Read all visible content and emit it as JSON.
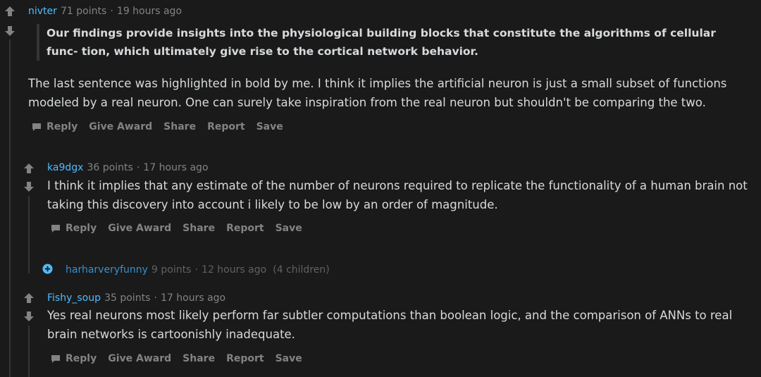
{
  "comments": [
    {
      "author": "nivter",
      "points": "71 points",
      "time": "19 hours ago",
      "quote": "Our findings provide insights into the physiological building blocks that constitute the algorithms of cellular func- tion, which ultimately give rise to the cortical network behavior.",
      "body": "The last sentence was highlighted in bold by me. I think it implies the artificial neuron is just a small subset of functions modeled by a real neuron. One can surely take inspiration from the real neuron but shouldn't be comparing the two."
    },
    {
      "author": "ka9dgx",
      "points": "36 points",
      "time": "17 hours ago",
      "body": "I think it implies that any estimate of the number of neurons required to replicate the functionality of a human brain not taking this discovery into account i likely to be low by an order of magnitude."
    },
    {
      "author": "harharveryfunny",
      "points": "9 points",
      "time": "12 hours ago",
      "children": "(4 children)"
    },
    {
      "author": "Fishy_soup",
      "points": "35 points",
      "time": "17 hours ago",
      "body": "Yes real neurons most likely perform far subtler computations than boolean logic, and the comparison of ANNs to real brain networks is cartoonishly inadequate."
    }
  ],
  "actions": {
    "reply": "Reply",
    "give_award": "Give Award",
    "share": "Share",
    "report": "Report",
    "save": "Save"
  },
  "separator": "·",
  "icons": {
    "upvote": "upvote-arrow-icon",
    "downvote": "downvote-arrow-icon",
    "reply": "speech-bubble-icon",
    "expand": "plus-circle-icon"
  },
  "colors": {
    "background": "#1a1a1b",
    "author": "#4fbcff",
    "meta": "#818384",
    "text": "#d7dadc"
  }
}
